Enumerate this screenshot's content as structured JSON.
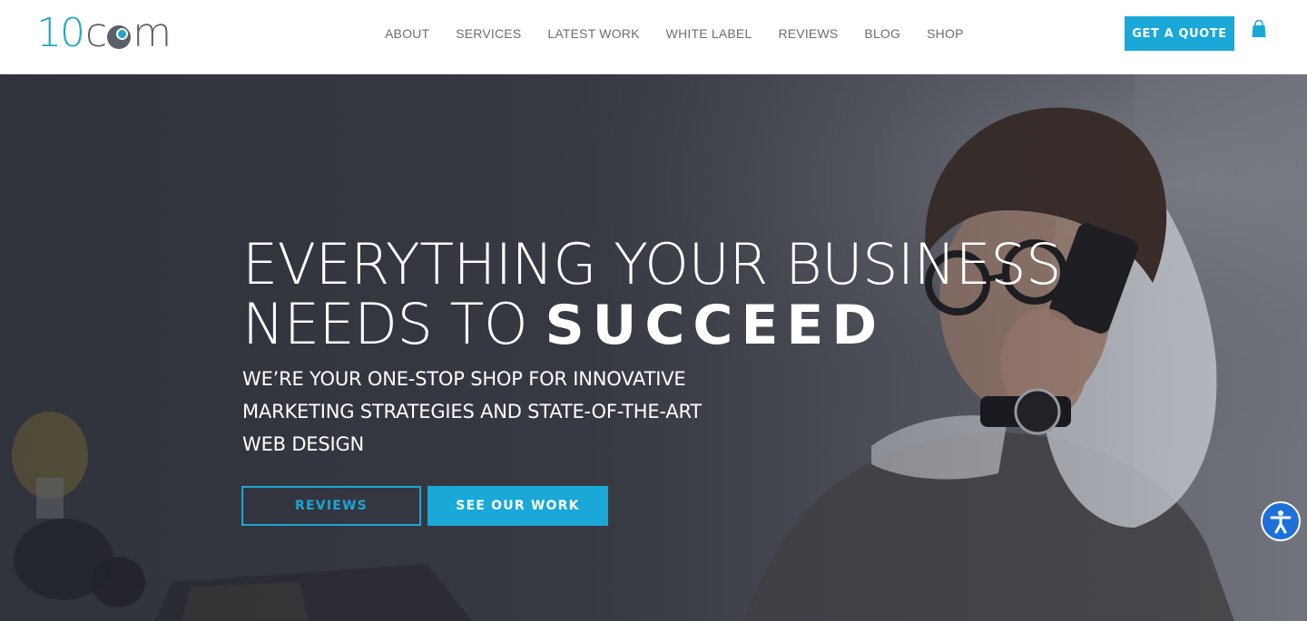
{
  "brand": {
    "logo_part1": "10",
    "logo_part2": "c",
    "logo_part3": "m",
    "accent_color": "#19a8d8",
    "logo_gray": "#5b5f67"
  },
  "nav": {
    "items": [
      {
        "label": "ABOUT"
      },
      {
        "label": "SERVICES"
      },
      {
        "label": "LATEST WORK"
      },
      {
        "label": "WHITE LABEL"
      },
      {
        "label": "REVIEWS"
      },
      {
        "label": "BLOG"
      },
      {
        "label": "SHOP"
      }
    ]
  },
  "header": {
    "quote_label": "GET A QUOTE",
    "cart_icon": "shopping-bag-icon"
  },
  "hero": {
    "headline_line1": "EVERYTHING YOUR BUSINESS",
    "headline_line2_prefix": "NEEDS TO",
    "headline_bold": "SUCCEED",
    "subtext": "WE’RE YOUR ONE-STOP SHOP FOR INNOVATIVE MARKETING STRATEGIES AND STATE-OF-THE-ART WEB DESIGN",
    "reviews_button": "REVIEWS",
    "work_button": "SEE OUR WORK"
  },
  "accessibility": {
    "icon": "accessibility-icon",
    "color": "#1e6fd9"
  }
}
